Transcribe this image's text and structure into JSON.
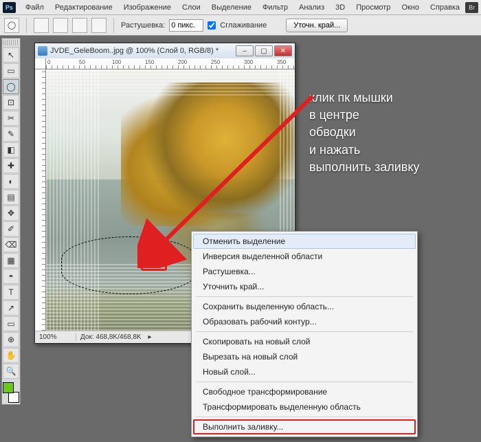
{
  "menubar": {
    "logo": "Ps",
    "items": [
      "Файл",
      "Редактирование",
      "Изображение",
      "Слои",
      "Выделение",
      "Фильтр",
      "Анализ",
      "3D",
      "Просмотр",
      "Окно",
      "Справка"
    ],
    "bridge": "Br"
  },
  "options": {
    "feather_label": "Растушевка:",
    "feather_value": "0 пикс.",
    "antialias_label": "Сглаживание",
    "refine_btn": "Уточн. край..."
  },
  "tools": {
    "list": [
      "↖",
      "▭",
      "◯",
      "⊡",
      "✂",
      "✎",
      "◧",
      "✚",
      "◐",
      "▤",
      "✥",
      "✐",
      "⌫",
      "▦",
      "◓",
      "▾",
      "◔",
      "●",
      "⬤",
      "⦿",
      "⟆",
      "T",
      "↗",
      "▭",
      "⊕",
      "✋",
      "🔍"
    ],
    "fg": "#6bc91c",
    "bg": "#ffffff"
  },
  "document": {
    "title": "JVDE_GeleBoom..jpg @ 100% (Слой 0, RGB/8) *",
    "ruler_marks": [
      "0",
      "50",
      "100",
      "150",
      "200",
      "250",
      "300",
      "350"
    ],
    "zoom": "100%",
    "size_info": "Док: 468,8K/468,8K"
  },
  "annotation": {
    "l1": "клик пк мышки",
    "l2": "в центре",
    "l3": "обводки",
    "l4": "и нажать",
    "l5": "выполнить заливку"
  },
  "context_menu": {
    "items": [
      {
        "label": "Отменить выделение",
        "hover": true
      },
      {
        "label": "Инверсия выделенной области"
      },
      {
        "label": "Растушевка..."
      },
      {
        "label": "Уточнить край..."
      },
      {
        "sep": true
      },
      {
        "label": "Сохранить выделенную область..."
      },
      {
        "label": "Образовать рабочий контур..."
      },
      {
        "sep": true
      },
      {
        "label": "Скопировать на новый слой"
      },
      {
        "label": "Вырезать на новый слой"
      },
      {
        "label": "Новый слой..."
      },
      {
        "sep": true
      },
      {
        "label": "Свободное трансформирование"
      },
      {
        "label": "Трансформировать выделенную область"
      },
      {
        "sep": true
      },
      {
        "label": "Выполнить заливку...",
        "highlight": true
      }
    ]
  }
}
